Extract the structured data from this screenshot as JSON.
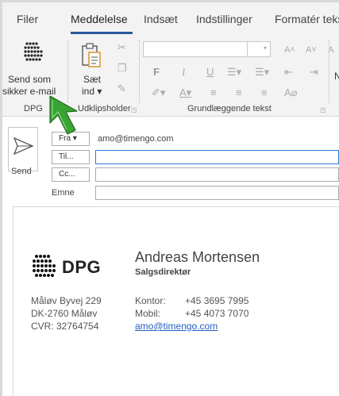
{
  "tabs": [
    {
      "label": "Filer"
    },
    {
      "label": "Meddelelse"
    },
    {
      "label": "Indsæt"
    },
    {
      "label": "Indstillinger"
    },
    {
      "label": "Formatér tekst"
    }
  ],
  "ribbon": {
    "dpg_group": {
      "button_line1": "Send som",
      "button_line2": "sikker e-mail",
      "group_label": "DPG"
    },
    "clipboard": {
      "paste_line1": "Sæt",
      "paste_line2": "ind ▾",
      "group_label": "Udklipsholder"
    },
    "font_group": {
      "group_label": "Grundlæggende tekst",
      "bold": "F",
      "italic": "I",
      "underline": "U"
    },
    "cut_off_label": "N"
  },
  "header": {
    "send_label": "Send",
    "from_button": "Fra ▾",
    "from_value": "amo@timengo.com",
    "to_button": "Til...",
    "cc_button": "Cc...",
    "subject_label": "Emne",
    "to_value": "",
    "cc_value": "",
    "subject_value": ""
  },
  "signature": {
    "logo_text": "DPG",
    "name": "Andreas Mortensen",
    "title": "Salgsdirektør",
    "address_line1": "Måløv Byvej 229",
    "address_line2": "DK-2760 Måløv",
    "address_line3": "CVR: 32764754",
    "office_label": "Kontor:",
    "office_phone": "+45 3695 7995",
    "mobile_label": "Mobil:",
    "mobile_phone": "+45 4073 7070",
    "email": "amo@timengo.com"
  },
  "colors": {
    "accent": "#2b579a",
    "arrow_green": "#3aa335",
    "link": "#1f5fbf"
  },
  "icons": [
    "dpg-logo-icon",
    "paste-icon",
    "cut-icon",
    "copy-icon",
    "format-painter-icon",
    "send-icon",
    "cursor-arrow-icon"
  ]
}
